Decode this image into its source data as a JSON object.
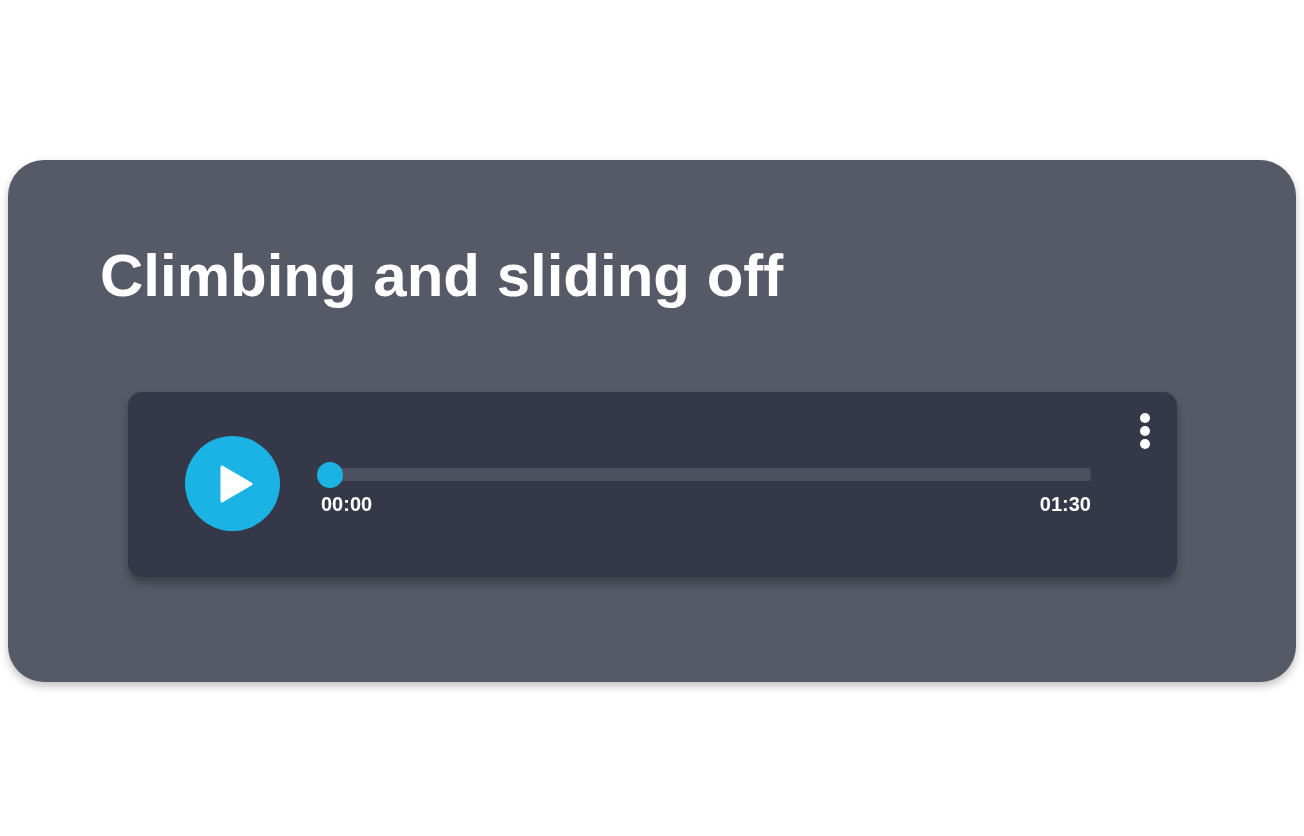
{
  "card": {
    "title": "Climbing and sliding off"
  },
  "player": {
    "playing": false,
    "level": 0,
    "elapsed": "00:00",
    "duration": "01:30"
  }
}
